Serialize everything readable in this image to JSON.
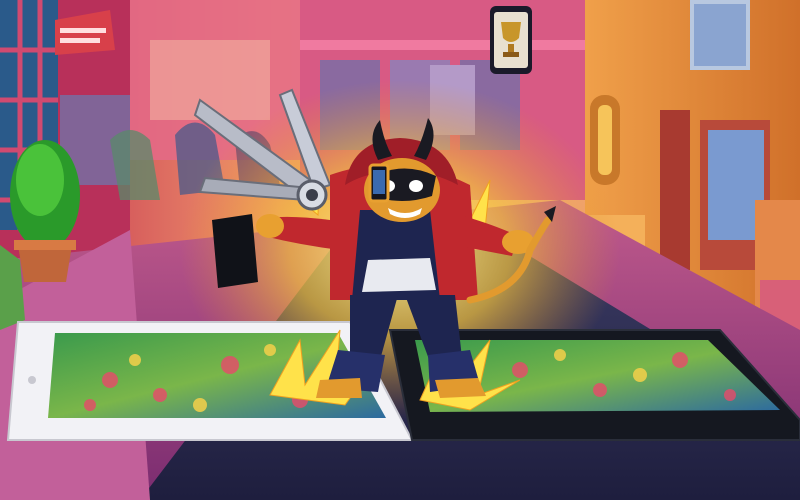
{
  "scene": {
    "description_label": "",
    "palette": {
      "sky_left": "#c8385c",
      "sky_mid": "#f0a070",
      "street": "#a24a8a",
      "building_right": "#e88a3c",
      "road_dark": "#2b2a4a",
      "tablet_white": "#f2f2f6",
      "tablet_black": "#151820",
      "jacket": "#c0282e",
      "pants": "#1e2550",
      "gold": "#f1c232"
    },
    "icons": {
      "trophy_sign": "trophy-icon",
      "phone_in_hand": "smartphone-icon",
      "scissors": "scissors-icon"
    }
  }
}
